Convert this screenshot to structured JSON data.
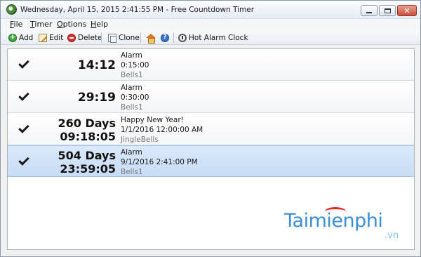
{
  "window": {
    "title": "Wednesday, April 15, 2015 2:41:55 PM - Free Countdown Timer",
    "close_glyph": "✕"
  },
  "menu": {
    "items": [
      "File",
      "Timer",
      "Options",
      "Help"
    ]
  },
  "toolbar": {
    "add_label": "Add",
    "edit_label": "Edit",
    "delete_label": "Delete",
    "clone_label": "Clone",
    "hot_alarm_label": "Hot Alarm Clock",
    "icons": [
      "add-icon",
      "edit-icon",
      "delete-icon",
      "clone-icon",
      "home-icon",
      "help-icon",
      "alarm-clock-icon"
    ]
  },
  "timers": [
    {
      "checked": true,
      "time_line1": "14:12",
      "time_line2": "",
      "name": "Alarm",
      "when": "0:15:00",
      "sound": "Bells1",
      "selected": false
    },
    {
      "checked": true,
      "time_line1": "29:19",
      "time_line2": "",
      "name": "Alarm",
      "when": "0:30:00",
      "sound": "Bells1",
      "selected": false
    },
    {
      "checked": true,
      "time_line1": "260 Days",
      "time_line2": "09:18:05",
      "name": "Happy New Year!",
      "when": "1/1/2016 12:00:00 AM",
      "sound": "JingleBells",
      "selected": false
    },
    {
      "checked": true,
      "time_line1": "504 Days",
      "time_line2": "23:59:05",
      "name": "Alarm",
      "when": "9/1/2016 2:41:00 PM",
      "sound": "Bells1",
      "selected": true
    }
  ],
  "watermark": {
    "main": "Taimienphi",
    "sub": ".vn"
  },
  "colors": {
    "selection": "#c7dcf6",
    "watermark_blue": "#3a8fd6",
    "watermark_arc": "#e02a2a"
  }
}
